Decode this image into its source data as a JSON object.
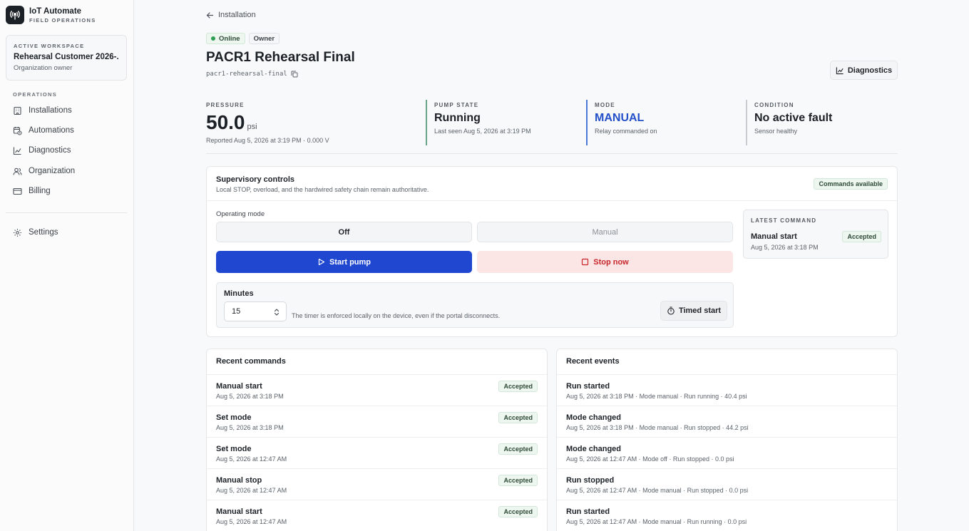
{
  "brand": {
    "title": "IoT Automate",
    "subtitle": "FIELD OPERATIONS"
  },
  "workspace": {
    "label": "ACTIVE WORKSPACE",
    "name": "Rehearsal Customer 2026-...",
    "role": "Organization owner"
  },
  "nav": {
    "section_label": "OPERATIONS",
    "items": [
      {
        "label": "Installations",
        "icon": "building-icon"
      },
      {
        "label": "Automations",
        "icon": "calendar-clock-icon"
      },
      {
        "label": "Diagnostics",
        "icon": "chart-line-icon"
      },
      {
        "label": "Organization",
        "icon": "users-icon"
      },
      {
        "label": "Billing",
        "icon": "credit-card-icon"
      }
    ],
    "settings_label": "Settings"
  },
  "header": {
    "back_label": "Installation",
    "status_badge": "Online",
    "role_badge": "Owner",
    "title": "PACR1 Rehearsal Final",
    "slug": "pacr1-rehearsal-final",
    "diagnostics_button": "Diagnostics"
  },
  "stats": {
    "pressure": {
      "label": "PRESSURE",
      "value": "50.0",
      "unit": "psi",
      "note": "Reported Aug 5, 2026 at 3:19 PM · 0.000 V"
    },
    "pump_state": {
      "label": "PUMP STATE",
      "value": "Running",
      "note": "Last seen Aug 5, 2026 at 3:19 PM"
    },
    "mode": {
      "label": "MODE",
      "value": "MANUAL",
      "note": "Relay commanded on"
    },
    "condition": {
      "label": "CONDITION",
      "value": "No active fault",
      "note": "Sensor healthy"
    }
  },
  "supervisory": {
    "title": "Supervisory controls",
    "subtitle": "Local STOP, overload, and the hardwired safety chain remain authoritative.",
    "availability": "Commands available",
    "operating_mode_label": "Operating mode",
    "mode_off": "Off",
    "mode_manual": "Manual",
    "start_button": "Start pump",
    "stop_button": "Stop now",
    "timer": {
      "label": "Minutes",
      "value": "15",
      "note": "The timer is enforced locally on the device, even if the portal disconnects.",
      "button": "Timed start"
    },
    "latest": {
      "label": "LATEST COMMAND",
      "name": "Manual start",
      "status": "Accepted",
      "time": "Aug 5, 2026 at 3:18 PM"
    }
  },
  "recent_commands": {
    "title": "Recent commands",
    "rows": [
      {
        "name": "Manual start",
        "time": "Aug 5, 2026 at 3:18 PM",
        "status": "Accepted"
      },
      {
        "name": "Set mode",
        "time": "Aug 5, 2026 at 3:18 PM",
        "status": "Accepted"
      },
      {
        "name": "Set mode",
        "time": "Aug 5, 2026 at 12:47 AM",
        "status": "Accepted"
      },
      {
        "name": "Manual stop",
        "time": "Aug 5, 2026 at 12:47 AM",
        "status": "Accepted"
      },
      {
        "name": "Manual start",
        "time": "Aug 5, 2026 at 12:47 AM",
        "status": "Accepted"
      }
    ]
  },
  "recent_events": {
    "title": "Recent events",
    "rows": [
      {
        "name": "Run started",
        "detail": "Aug 5, 2026 at 3:18 PM · Mode manual · Run running · 40.4 psi"
      },
      {
        "name": "Mode changed",
        "detail": "Aug 5, 2026 at 3:18 PM · Mode manual · Run stopped · 44.2 psi"
      },
      {
        "name": "Mode changed",
        "detail": "Aug 5, 2026 at 12:47 AM · Mode off · Run stopped · 0.0 psi"
      },
      {
        "name": "Run stopped",
        "detail": "Aug 5, 2026 at 12:47 AM · Mode manual · Run stopped · 0.0 psi"
      },
      {
        "name": "Run started",
        "detail": "Aug 5, 2026 at 12:47 AM · Mode manual · Run running · 0.0 psi"
      }
    ]
  },
  "colors": {
    "accent": "#1f47cf",
    "danger": "#c8262b",
    "success": "#2f9e55",
    "mode_blue": "#2450c8"
  }
}
